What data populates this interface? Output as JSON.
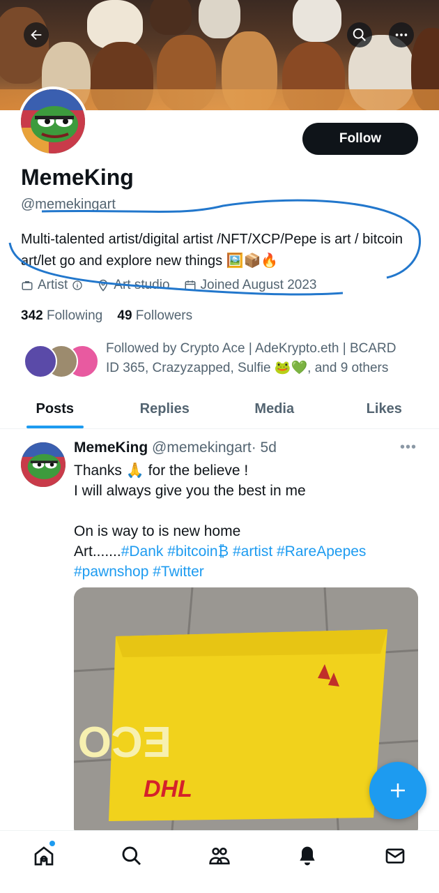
{
  "profile": {
    "name": "MemeKing",
    "handle": "@memekingart",
    "bio": "Multi-talented artist/digital artist /NFT/XCP/Pepe is art / bitcoin art/let go and explore new things 🖼️📦🔥",
    "category": "Artist",
    "location": "Art studio",
    "joined": "Joined August 2023",
    "following_count": "342",
    "following_label": "Following",
    "followers_count": "49",
    "followers_label": "Followers",
    "followed_by": "Followed by Crypto Ace | AdeKrypto.eth | BCARD ID 365, Crazyzapped, Sulfie 🐸💚, and 9 others"
  },
  "actions": {
    "follow_label": "Follow"
  },
  "tabs": [
    {
      "label": "Posts",
      "active": true
    },
    {
      "label": "Replies",
      "active": false
    },
    {
      "label": "Media",
      "active": false
    },
    {
      "label": "Likes",
      "active": false
    }
  ],
  "post": {
    "author": "MemeKing",
    "handle": "@memekingart",
    "time": "· 5d",
    "text_plain": "Thanks 🙏 for the believe !\nI will always give you the best in me\n\nOn is way to is new home\nArt.......",
    "hashtags": "#Dank #bitcoin₿ #artist #RareApepes #pawnshop #Twitter",
    "more": "•••"
  },
  "icons": {
    "back": "arrow-left-icon",
    "search": "search-icon",
    "more": "more-icon",
    "fab": "plus-icon"
  },
  "colors": {
    "accent": "#1d9bf0",
    "text": "#0f1419",
    "muted": "#536471"
  }
}
